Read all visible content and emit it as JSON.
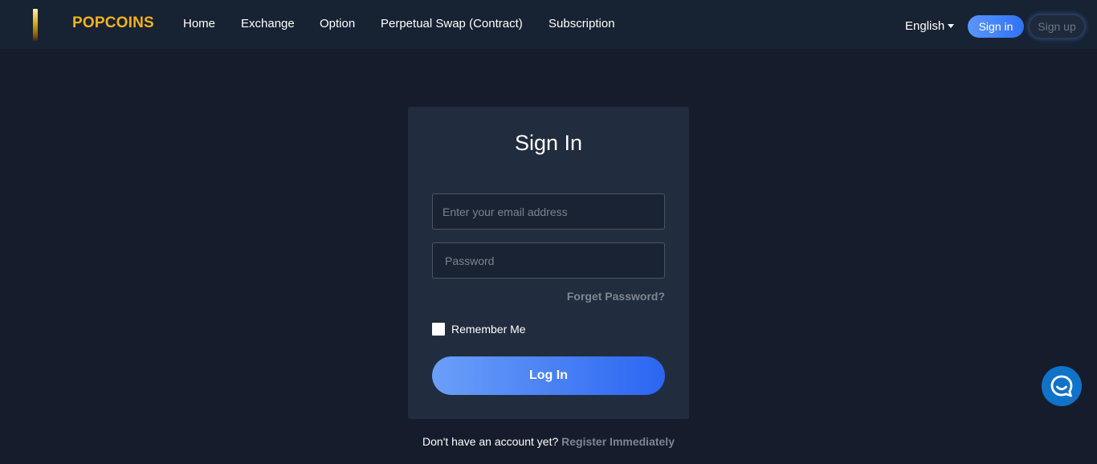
{
  "header": {
    "brand": "POPCOINS",
    "nav": [
      {
        "label": "Home"
      },
      {
        "label": "Exchange"
      },
      {
        "label": "Option"
      },
      {
        "label": "Perpetual Swap (Contract)"
      },
      {
        "label": "Subscription"
      }
    ],
    "language": "English",
    "signin_label": "Sign in",
    "signup_label": "Sign up"
  },
  "form": {
    "title": "Sign In",
    "email_placeholder": "Enter your email address",
    "email_value": "",
    "password_placeholder": "Password",
    "password_value": "",
    "forget_label": "Forget Password?",
    "remember_label": "Remember Me",
    "remember_checked": false,
    "login_label": "Log In"
  },
  "footer": {
    "prompt": "Don't have an account yet?",
    "register_label": "Register Immediately"
  },
  "colors": {
    "background": "#151d2c",
    "header": "#172232",
    "card": "#212c3e",
    "brand": "#f2b31c",
    "accent": "#2f72f5",
    "chat_widget": "#1172c9"
  },
  "icons": {
    "logo": "gold-bar-icon",
    "language_dropdown": "caret-down-icon",
    "chat": "chat-bubble-icon"
  }
}
